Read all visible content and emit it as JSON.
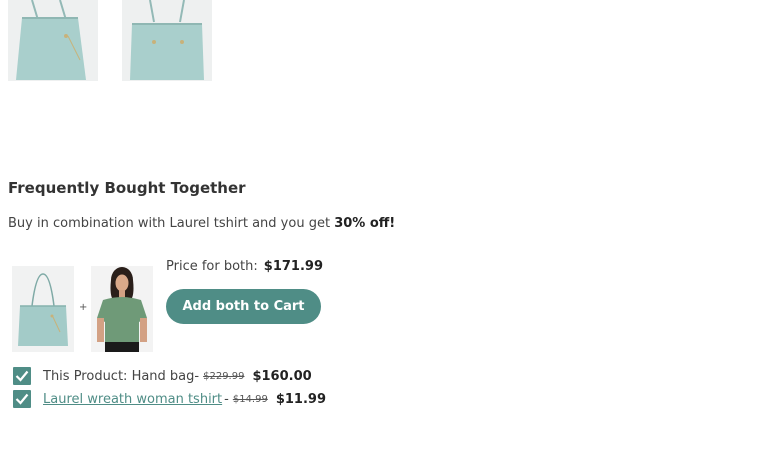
{
  "gallery": {
    "thumbnails": [
      {
        "alt": "hand-bag-thumbnail"
      },
      {
        "alt": "hand-bag-thumbnail"
      }
    ]
  },
  "fbt": {
    "title": "Frequently Bought Together",
    "subtitle_prefix": "Buy in combination with Laurel tshirt and you get ",
    "subtitle_discount": "30% off!",
    "plus": "+",
    "price_label": "Price for both:",
    "price_total": "$171.99",
    "add_button": "Add both to Cart",
    "items": [
      {
        "label": "This Product: Hand bag",
        "separator": " -",
        "old_price": "$229.99",
        "new_price": "$160.00",
        "checked": true
      },
      {
        "label": "Laurel wreath woman tshirt ",
        "separator": "-",
        "old_price": "$14.99",
        "new_price": "$11.99",
        "checked": true
      }
    ]
  },
  "colors": {
    "accent": "#4f8d86",
    "bag": "#a9cfcc",
    "shirt": "#6f9a78"
  }
}
